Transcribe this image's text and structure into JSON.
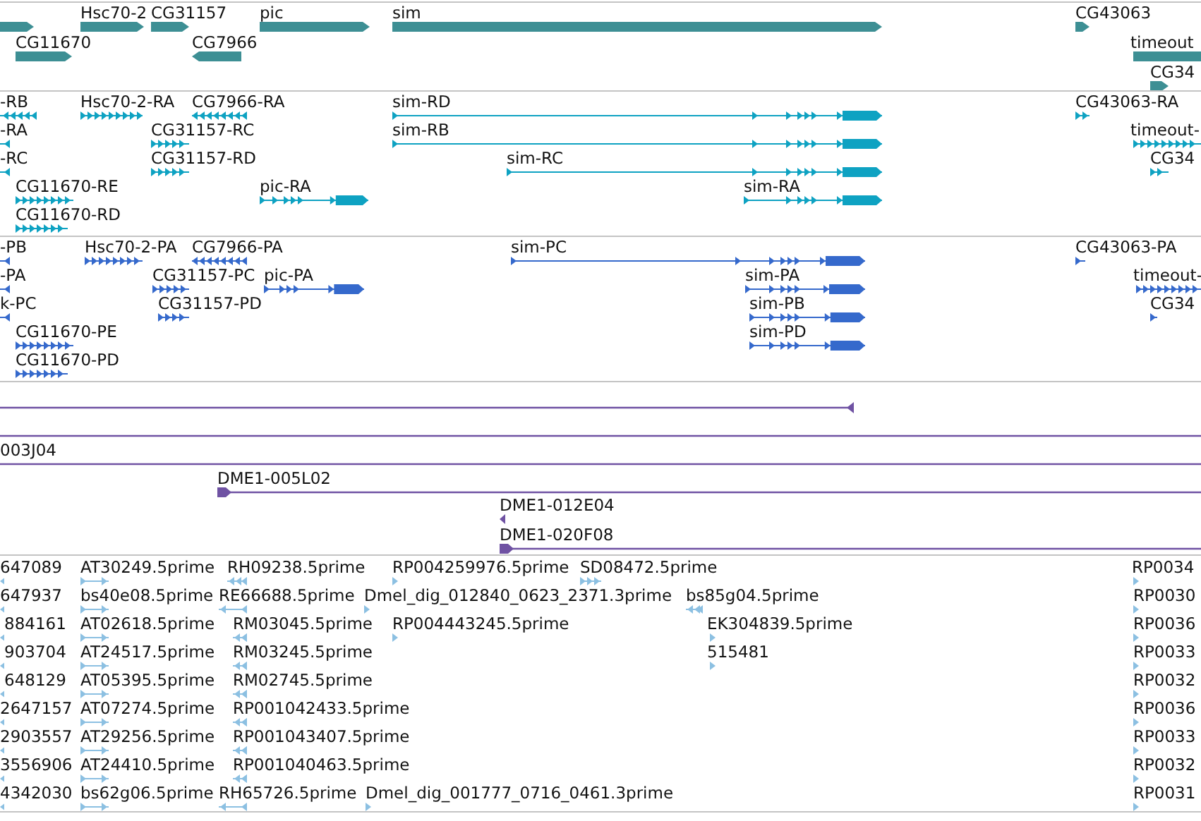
{
  "tracks": [
    {
      "kind": "gene",
      "color": "#3d8f94",
      "features": [
        {
          "reverse": false
        },
        {
          "label": "Hsc70-2",
          "reverse": false
        },
        {
          "label": "CG31157",
          "reverse": false
        },
        {
          "label": "pic",
          "reverse": false
        },
        {
          "label": "sim",
          "reverse": false
        },
        {
          "label": "CG11670",
          "reverse": false
        },
        {
          "label": "CG7966",
          "reverse": true
        },
        {
          "label": "CG43063",
          "reverse": false
        },
        {
          "label": "timeout",
          "reverse": false
        },
        {
          "label": "CG34",
          "reverse": false
        }
      ]
    },
    {
      "kind": "transcript",
      "color": "#0ea2c2",
      "features": [
        {
          "label": "-RB",
          "reverse": true
        },
        {
          "label": "Hsc70-2-RA",
          "reverse": false
        },
        {
          "label": "CG7966-RA",
          "reverse": true
        },
        {
          "label": "sim-RD",
          "reverse": false
        },
        {
          "label": "CG43063-RA",
          "reverse": false
        },
        {
          "label": "-RA",
          "reverse": true
        },
        {
          "label": "CG31157-RC",
          "reverse": false
        },
        {
          "label": "sim-RB",
          "reverse": false
        },
        {
          "label": "timeout-",
          "reverse": false
        },
        {
          "label": "-RC",
          "reverse": true
        },
        {
          "label": "CG31157-RD",
          "reverse": false
        },
        {
          "label": "sim-RC",
          "reverse": false
        },
        {
          "label": "CG34",
          "reverse": false
        },
        {
          "label": "CG11670-RE",
          "reverse": false
        },
        {
          "label": "pic-RA",
          "reverse": false
        },
        {
          "label": "sim-RA",
          "reverse": false
        },
        {
          "label": "CG11670-RD",
          "reverse": false
        }
      ]
    },
    {
      "kind": "transcript",
      "color": "#3569cc",
      "features": [
        {
          "label": "-PB",
          "reverse": true
        },
        {
          "label": "Hsc70-2-PA",
          "reverse": false
        },
        {
          "label": "CG7966-PA",
          "reverse": true
        },
        {
          "label": "sim-PC",
          "reverse": false
        },
        {
          "label": "CG43063-PA",
          "reverse": false
        },
        {
          "label": "-PA",
          "reverse": true
        },
        {
          "label": "CG31157-PC",
          "reverse": false
        },
        {
          "label": "pic-PA",
          "reverse": false
        },
        {
          "label": "sim-PA",
          "reverse": false
        },
        {
          "label": "timeout-",
          "reverse": false
        },
        {
          "label": "k-PC",
          "reverse": true
        },
        {
          "label": "CG31157-PD",
          "reverse": false
        },
        {
          "label": "sim-PB",
          "reverse": false
        },
        {
          "label": "CG34",
          "reverse": false
        },
        {
          "label": "CG11670-PE",
          "reverse": false
        },
        {
          "label": "sim-PD",
          "reverse": false
        },
        {
          "label": "CG11670-PD",
          "reverse": false
        }
      ]
    },
    {
      "kind": "alignment",
      "color": "#6f52a3",
      "features": [
        {
          "reverse": true
        },
        {
          "reverse": false
        },
        {
          "label": "003J04",
          "reverse": false
        },
        {
          "label": "DME1-005L02",
          "reverse": false
        },
        {
          "label": "DME1-012E04",
          "reverse": true
        },
        {
          "label": "DME1-020F08",
          "reverse": false
        }
      ]
    },
    {
      "kind": "read",
      "color": "#8cc0e2",
      "features": [
        {
          "label": "647089",
          "reverse": true
        },
        {
          "label": "AT30249.5prime",
          "reverse": false
        },
        {
          "label": "RH09238.5prime",
          "reverse": true
        },
        {
          "label": "RP004259976.5prime",
          "reverse": false
        },
        {
          "label": "SD08472.5prime",
          "reverse": false
        },
        {
          "label": "RP0034",
          "reverse": false
        },
        {
          "label": "647937",
          "reverse": true
        },
        {
          "label": "bs40e08.5prime",
          "reverse": false
        },
        {
          "label": "RE66688.5prime",
          "reverse": true
        },
        {
          "label": "Dmel_dig_012840_0623_2371.3prime",
          "reverse": false
        },
        {
          "label": "bs85g04.5prime",
          "reverse": true
        },
        {
          "label": "RP0030",
          "reverse": false
        },
        {
          "label": "884161",
          "reverse": true
        },
        {
          "label": "AT02618.5prime",
          "reverse": false
        },
        {
          "label": "RM03045.5prime",
          "reverse": true
        },
        {
          "label": "RP004443245.5prime",
          "reverse": false
        },
        {
          "label": "EK304839.5prime",
          "reverse": false
        },
        {
          "label": "RP0036",
          "reverse": false
        },
        {
          "label": "903704",
          "reverse": true
        },
        {
          "label": "AT24517.5prime",
          "reverse": false
        },
        {
          "label": "RM03245.5prime",
          "reverse": true
        },
        {
          "label": "515481",
          "reverse": false
        },
        {
          "label": "RP0033",
          "reverse": false
        },
        {
          "label": "648129",
          "reverse": true
        },
        {
          "label": "AT05395.5prime",
          "reverse": false
        },
        {
          "label": "RM02745.5prime",
          "reverse": true
        },
        {
          "label": "RP0032",
          "reverse": false
        },
        {
          "label": "2647157",
          "reverse": true
        },
        {
          "label": "AT07274.5prime",
          "reverse": false
        },
        {
          "label": "RP001042433.5prime",
          "reverse": true
        },
        {
          "label": "RP0036",
          "reverse": false
        },
        {
          "label": "2903557",
          "reverse": true
        },
        {
          "label": "AT29256.5prime",
          "reverse": false
        },
        {
          "label": "RP001043407.5prime",
          "reverse": true
        },
        {
          "label": "RP0033",
          "reverse": false
        },
        {
          "label": "3556906",
          "reverse": true
        },
        {
          "label": "AT24410.5prime",
          "reverse": false
        },
        {
          "label": "RP001040463.5prime",
          "reverse": true
        },
        {
          "label": "RP0032",
          "reverse": false
        },
        {
          "label": "4342030",
          "reverse": true
        },
        {
          "label": "bs62g06.5prime",
          "reverse": false
        },
        {
          "label": "RH65726.5prime",
          "reverse": true
        },
        {
          "label": "Dmel_dig_001777_0716_0461.3prime",
          "reverse": false
        },
        {
          "label": "RP0031",
          "reverse": false
        }
      ]
    }
  ]
}
